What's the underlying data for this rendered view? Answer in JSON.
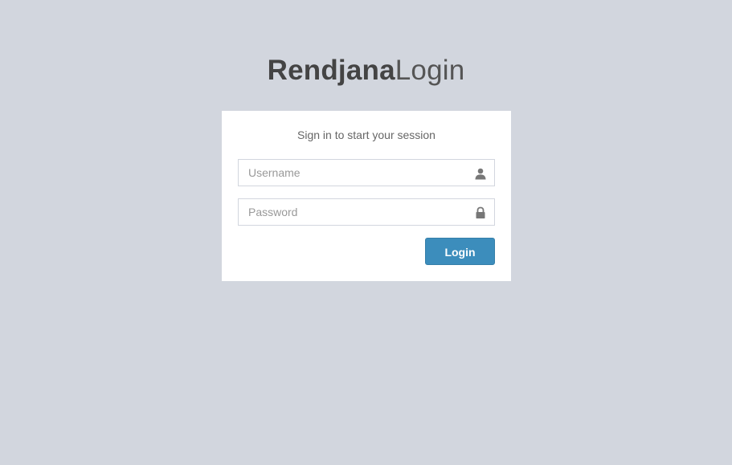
{
  "logo": {
    "bold": "Rendjana",
    "light": "Login"
  },
  "login_box": {
    "message": "Sign in to start your session",
    "username": {
      "value": "",
      "placeholder": "Username",
      "icon": "user-icon"
    },
    "password": {
      "value": "",
      "placeholder": "Password",
      "icon": "lock-icon"
    },
    "submit_label": "Login"
  },
  "colors": {
    "background": "#d2d6de",
    "box": "#ffffff",
    "button": "#3c8dbc",
    "icon": "#777777"
  }
}
